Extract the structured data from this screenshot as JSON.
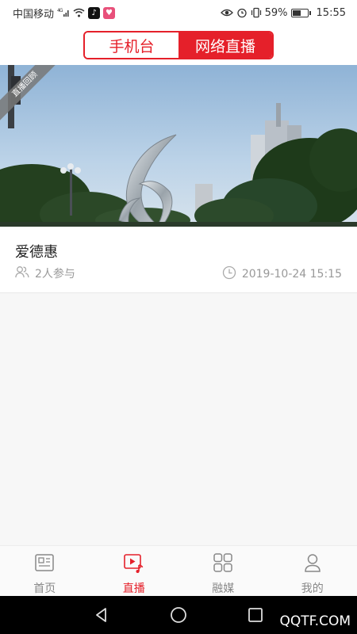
{
  "status_bar": {
    "carrier": "中国移动",
    "signal_label": "4G",
    "battery_percent": "59%",
    "battery_level": 0.59,
    "time": "15:55"
  },
  "header": {
    "tabs": [
      {
        "label": "手机台",
        "active": false
      },
      {
        "label": "网络直播",
        "active": true
      }
    ]
  },
  "live_card": {
    "badge": "直播回顾",
    "title": "爱德惠",
    "participants": "2人参与",
    "datetime": "2019-10-24 15:15"
  },
  "tabbar": {
    "items": [
      {
        "label": "首页",
        "icon": "news-icon",
        "active": false
      },
      {
        "label": "直播",
        "icon": "live-video-icon",
        "active": true
      },
      {
        "label": "融媒",
        "icon": "grid-icon",
        "active": false
      },
      {
        "label": "我的",
        "icon": "user-icon",
        "active": false
      }
    ]
  },
  "watermark": "QQTF.COM",
  "colors": {
    "accent": "#e5202a",
    "inactive": "#888888"
  }
}
